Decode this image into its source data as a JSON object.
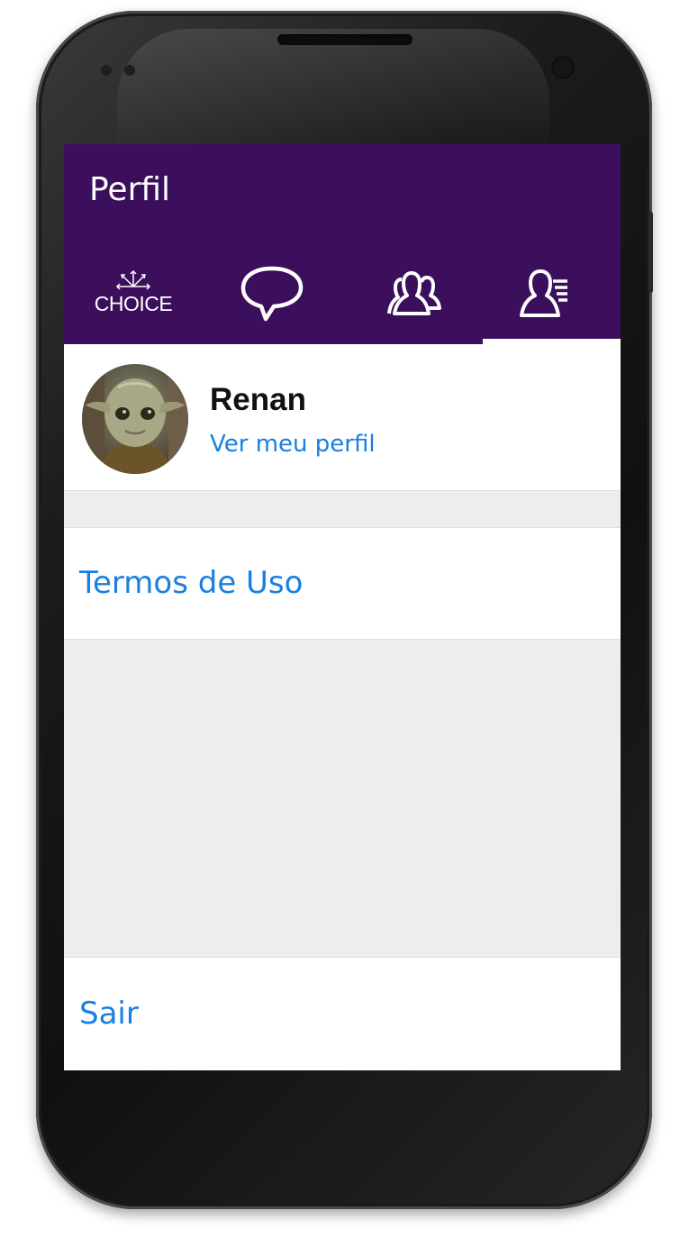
{
  "app_bar": {
    "title": "Perfil",
    "background_color": "#3b0f5c",
    "tabs": [
      {
        "id": "choice",
        "icon": "choice-logo-icon",
        "label": "CHOICE"
      },
      {
        "id": "chat",
        "icon": "speech-bubble-icon"
      },
      {
        "id": "friends",
        "icon": "people-icon"
      },
      {
        "id": "profile",
        "icon": "profile-list-icon",
        "selected": true
      }
    ]
  },
  "profile": {
    "name": "Renan",
    "link_label": "Ver meu perfil",
    "avatar_icon": "avatar-photo"
  },
  "menu": {
    "terms_label": "Termos de Uso",
    "logout_label": "Sair"
  },
  "colors": {
    "accent_link": "#1a7fe0",
    "background": "#ededed"
  }
}
